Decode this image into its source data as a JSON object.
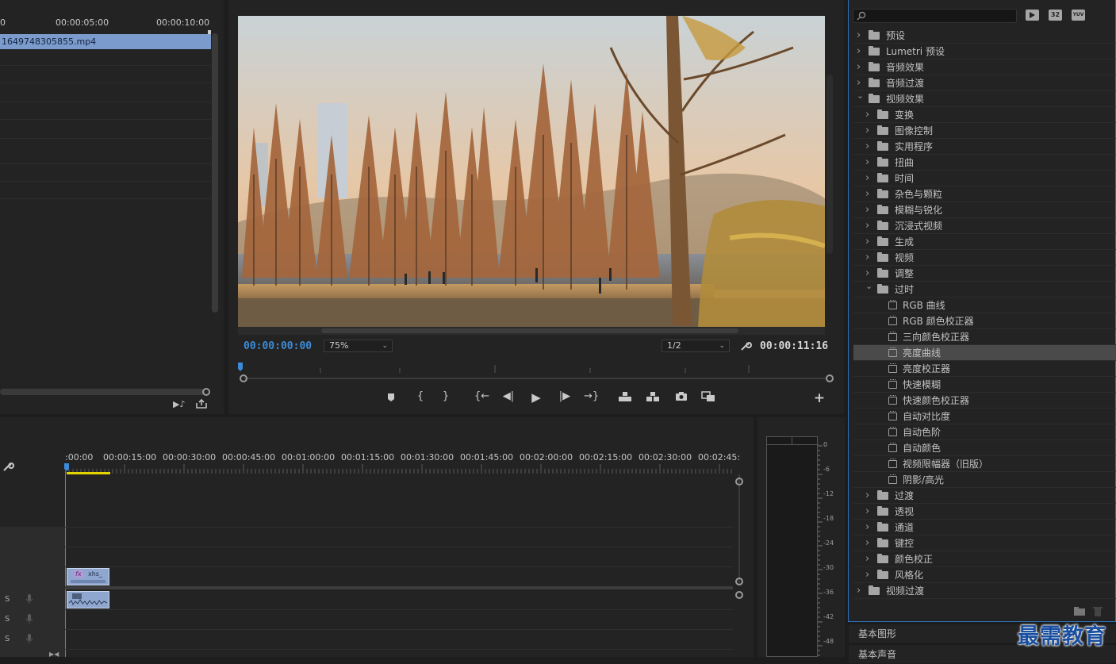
{
  "source_panel": {
    "ruler_labels": [
      "0",
      "00:00:05:00",
      "00:00:10:00"
    ],
    "clip_name": "1649748305855.mp4"
  },
  "program_monitor": {
    "current_time": "00:00:00:00",
    "zoom": "75%",
    "resolution": "1/2",
    "duration": "00:00:11:16"
  },
  "effects_panel": {
    "items": [
      {
        "label": "预设",
        "level": 0,
        "type": "folder",
        "expanded": false
      },
      {
        "label": "Lumetri 预设",
        "level": 0,
        "type": "folder",
        "expanded": false
      },
      {
        "label": "音频效果",
        "level": 0,
        "type": "folder",
        "expanded": false
      },
      {
        "label": "音频过渡",
        "level": 0,
        "type": "folder",
        "expanded": false
      },
      {
        "label": "视频效果",
        "level": 0,
        "type": "folder",
        "expanded": true
      },
      {
        "label": "变换",
        "level": 1,
        "type": "folder",
        "expanded": false
      },
      {
        "label": "图像控制",
        "level": 1,
        "type": "folder",
        "expanded": false
      },
      {
        "label": "实用程序",
        "level": 1,
        "type": "folder",
        "expanded": false
      },
      {
        "label": "扭曲",
        "level": 1,
        "type": "folder",
        "expanded": false
      },
      {
        "label": "时间",
        "level": 1,
        "type": "folder",
        "expanded": false
      },
      {
        "label": "杂色与颗粒",
        "level": 1,
        "type": "folder",
        "expanded": false
      },
      {
        "label": "模糊与锐化",
        "level": 1,
        "type": "folder",
        "expanded": false
      },
      {
        "label": "沉浸式视频",
        "level": 1,
        "type": "folder",
        "expanded": false
      },
      {
        "label": "生成",
        "level": 1,
        "type": "folder",
        "expanded": false
      },
      {
        "label": "视频",
        "level": 1,
        "type": "folder",
        "expanded": false
      },
      {
        "label": "调整",
        "level": 1,
        "type": "folder",
        "expanded": false
      },
      {
        "label": "过时",
        "level": 1,
        "type": "folder",
        "expanded": true
      },
      {
        "label": "RGB 曲线",
        "level": 2,
        "type": "effect"
      },
      {
        "label": "RGB 颜色校正器",
        "level": 2,
        "type": "effect"
      },
      {
        "label": "三向颜色校正器",
        "level": 2,
        "type": "effect"
      },
      {
        "label": "亮度曲线",
        "level": 2,
        "type": "effect",
        "selected": true
      },
      {
        "label": "亮度校正器",
        "level": 2,
        "type": "effect"
      },
      {
        "label": "快速模糊",
        "level": 2,
        "type": "effect"
      },
      {
        "label": "快速颜色校正器",
        "level": 2,
        "type": "effect"
      },
      {
        "label": "自动对比度",
        "level": 2,
        "type": "effect"
      },
      {
        "label": "自动色阶",
        "level": 2,
        "type": "effect"
      },
      {
        "label": "自动颜色",
        "level": 2,
        "type": "effect"
      },
      {
        "label": "视频限幅器（旧版）",
        "level": 2,
        "type": "effect"
      },
      {
        "label": "阴影/高光",
        "level": 2,
        "type": "effect"
      },
      {
        "label": "过渡",
        "level": 1,
        "type": "folder",
        "expanded": false
      },
      {
        "label": "透视",
        "level": 1,
        "type": "folder",
        "expanded": false
      },
      {
        "label": "通道",
        "level": 1,
        "type": "folder",
        "expanded": false
      },
      {
        "label": "键控",
        "level": 1,
        "type": "folder",
        "expanded": false
      },
      {
        "label": "颜色校正",
        "level": 1,
        "type": "folder",
        "expanded": false
      },
      {
        "label": "风格化",
        "level": 1,
        "type": "folder",
        "expanded": false
      },
      {
        "label": "视频过渡",
        "level": 0,
        "type": "folder",
        "expanded": false
      }
    ],
    "filter_badges": [
      "32",
      "YUV"
    ]
  },
  "timeline": {
    "ruler_labels": [
      ":00:00",
      "00:00:15:00",
      "00:00:30:00",
      "00:00:45:00",
      "00:01:00:00",
      "00:01:15:00",
      "00:01:30:00",
      "00:01:45:00",
      "00:02:00:00",
      "00:02:15:00",
      "00:02:30:00",
      "00:02:45:"
    ],
    "video_clip_label": "xhs_",
    "fx_badge": "fx",
    "audio_track_letters": [
      "S",
      "S",
      "S"
    ]
  },
  "audio_meter": {
    "db_labels": [
      "0",
      "-6",
      "-12",
      "-18",
      "-24",
      "-30",
      "-36",
      "-42",
      "-48"
    ]
  },
  "bottom_tabs": [
    "基本图形",
    "基本声音"
  ],
  "watermark": "最需教育",
  "colors": {
    "accent_blue": "#3d8bd8",
    "clip_blue": "#7b9bcc",
    "selected_row": "#4a4a4a",
    "playhead_yellow": "#e5d400"
  }
}
